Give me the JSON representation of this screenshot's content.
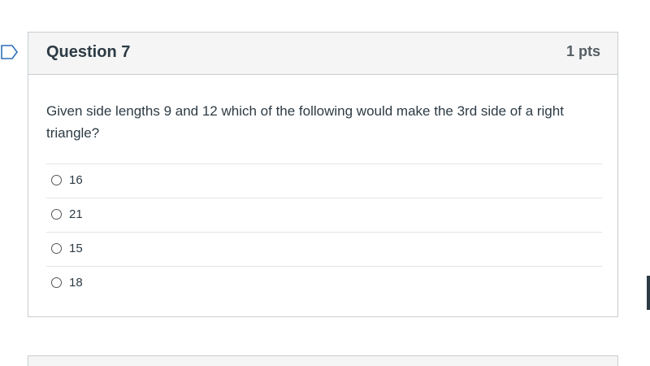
{
  "question": {
    "title": "Question 7",
    "points": "1 pts",
    "text": "Given side lengths 9 and 12 which of the following would make the 3rd side of a right triangle?",
    "answers": [
      {
        "label": "16"
      },
      {
        "label": "21"
      },
      {
        "label": "15"
      },
      {
        "label": "18"
      }
    ]
  },
  "icons": {
    "flag": "flag-question-icon",
    "radio": "radio-button-icon"
  },
  "colors": {
    "header_bg": "#f5f5f5",
    "border": "#c7cdd1",
    "text": "#2d3b45",
    "flag": "#2d6fb7"
  }
}
